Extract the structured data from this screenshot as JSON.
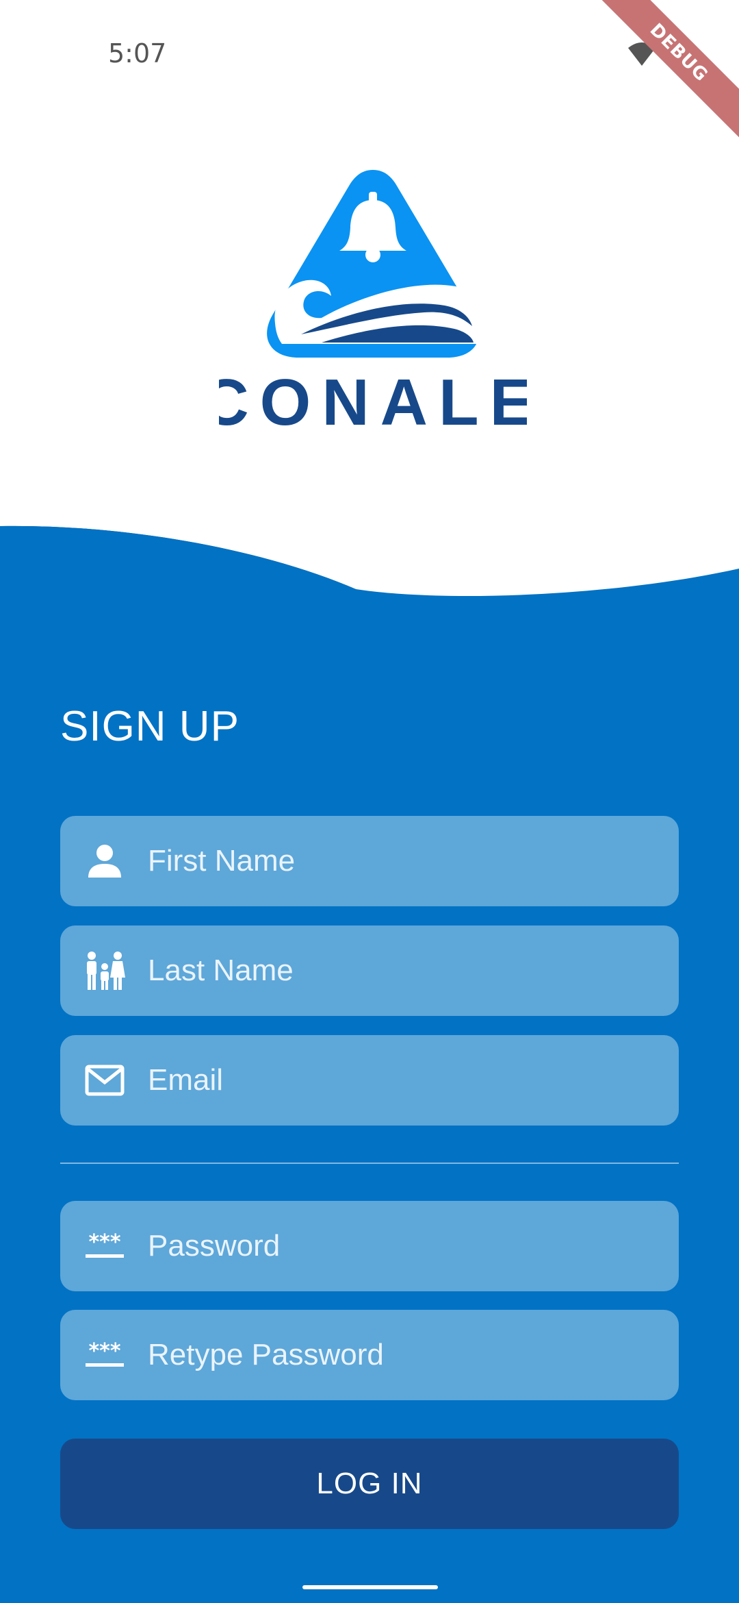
{
  "status_bar": {
    "time": "5:07",
    "icons": [
      "wifi-icon",
      "battery-icon"
    ]
  },
  "debug_banner": "DEBUG",
  "logo": {
    "text": "CONALE",
    "icon": "bell-wave-logo-icon"
  },
  "form": {
    "title": "SIGN UP",
    "fields": {
      "first_name": {
        "placeholder": "First Name",
        "icon": "person-icon"
      },
      "last_name": {
        "placeholder": "Last Name",
        "icon": "family-icon"
      },
      "email": {
        "placeholder": "Email",
        "icon": "mail-icon"
      },
      "password": {
        "placeholder": "Password",
        "icon": "password-icon"
      },
      "retype_password": {
        "placeholder": "Retype Password",
        "icon": "password-icon"
      }
    },
    "submit_label": "LOG IN"
  },
  "colors": {
    "primary_blue": "#0272c4",
    "dark_blue": "#17498a",
    "field_bg": "#5ea7d9",
    "logo_light_blue": "#0a93f2"
  }
}
